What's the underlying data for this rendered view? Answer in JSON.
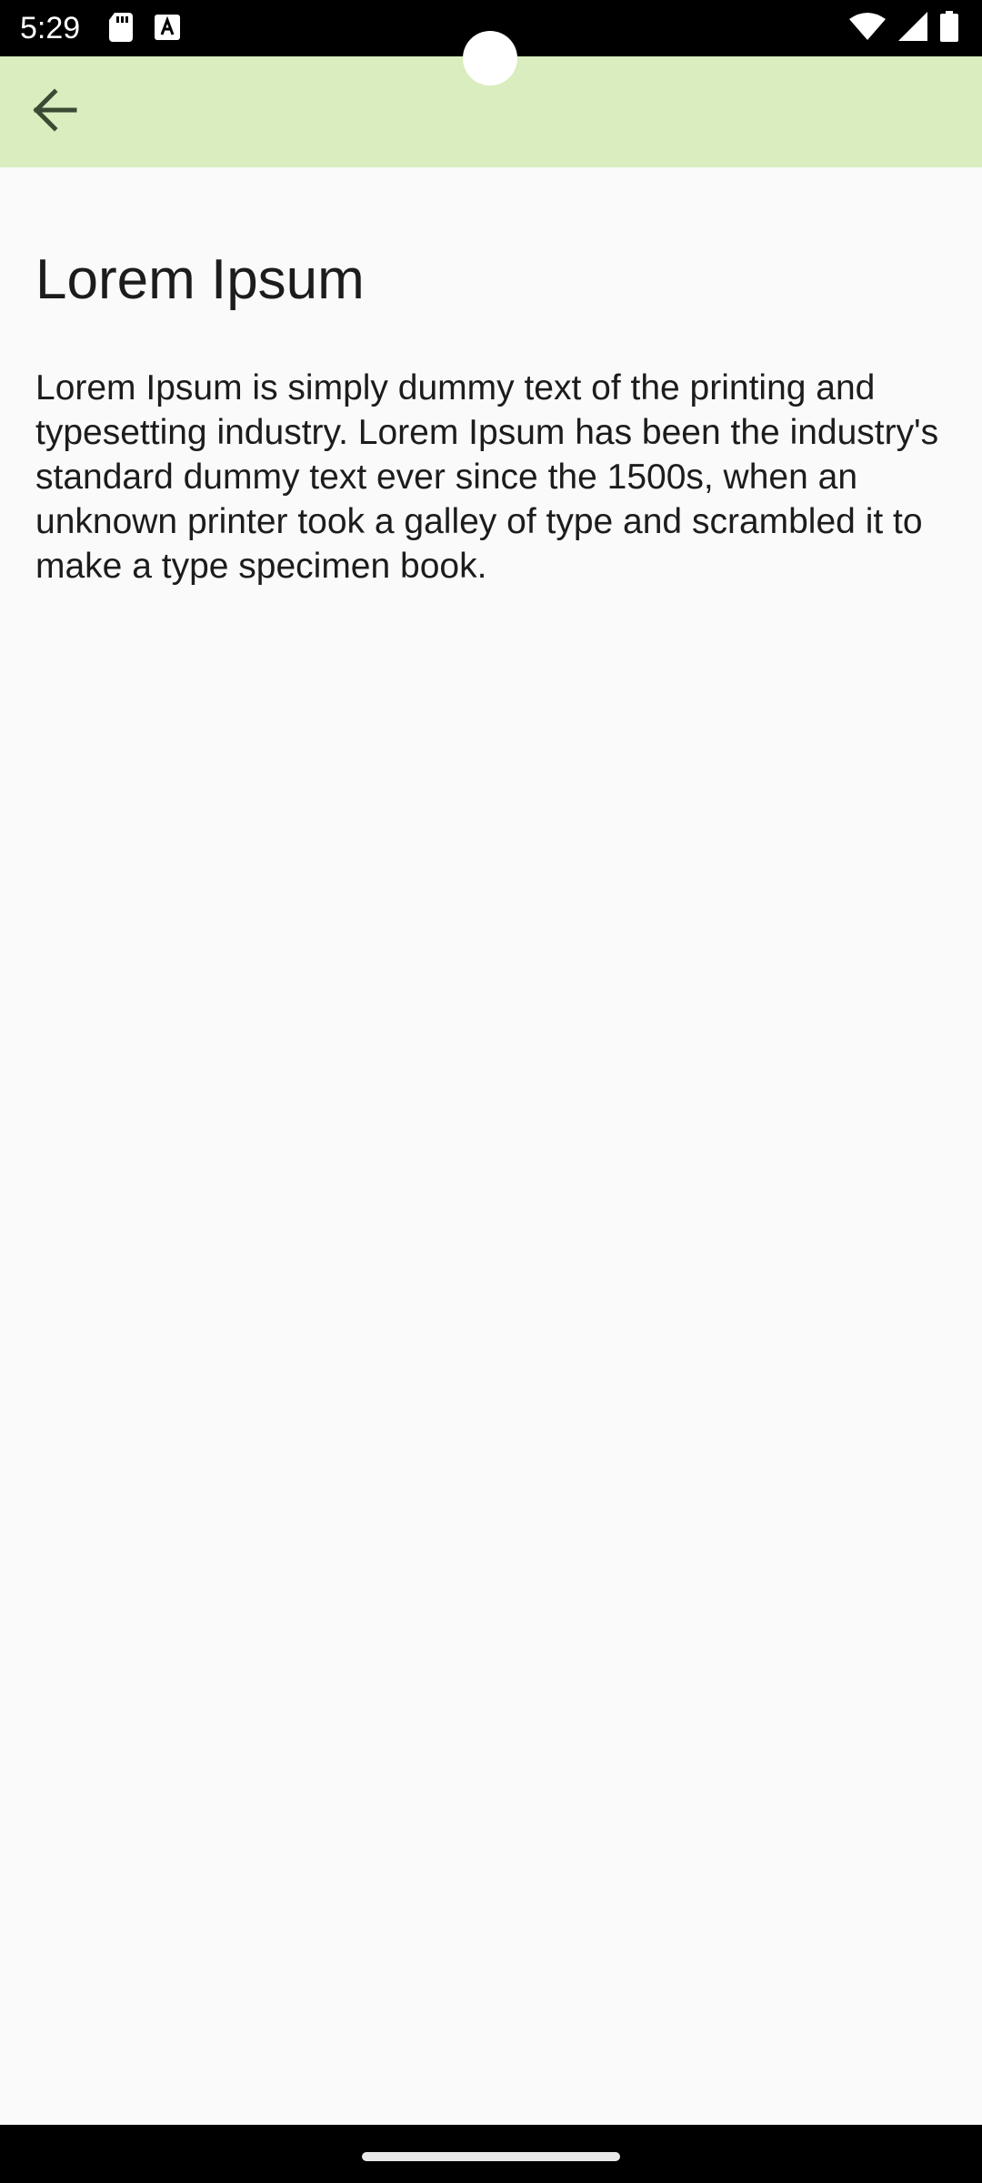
{
  "status_bar": {
    "time": "5:29",
    "left_icons": [
      "sd-card-icon",
      "text-a-icon"
    ],
    "right_icons": [
      "wifi-icon",
      "cell-signal-icon",
      "battery-icon"
    ]
  },
  "app_bar": {
    "back_icon": "arrow-back-icon",
    "background_color": "#d9edbf"
  },
  "content": {
    "title": "Lorem Ipsum",
    "body": "Lorem Ipsum is simply dummy text of the printing and typesetting industry. Lorem Ipsum has been the industry's standard dummy text ever since the 1500s, when an unknown printer took a galley of type and scrambled it to make a type specimen book."
  },
  "colors": {
    "background": "#fafafa",
    "text": "#1c1c1c",
    "system_bars": "#000000"
  }
}
